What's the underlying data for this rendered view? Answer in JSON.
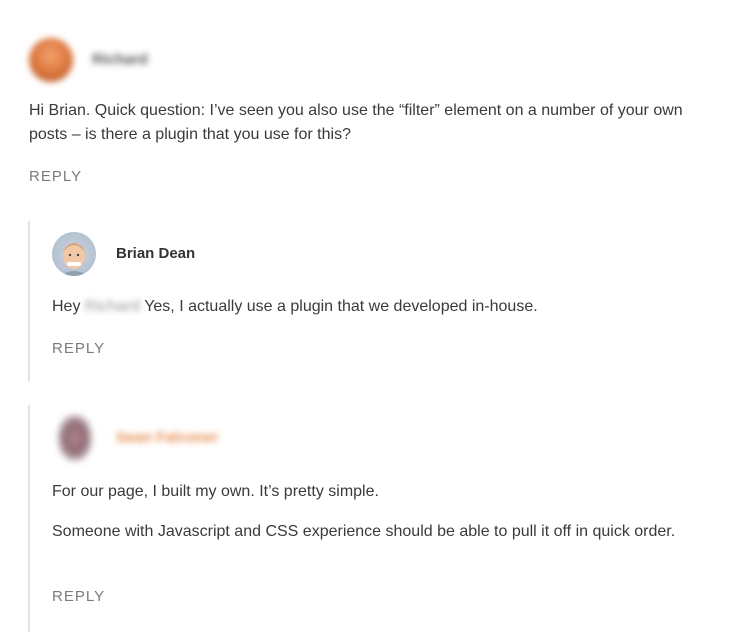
{
  "comments": [
    {
      "author": "Richard",
      "text": "Hi Brian. Quick question: I’ve seen you also use the “filter” element on a number of your own posts – is there a plugin that you use for this?",
      "reply_label": "REPLY"
    },
    {
      "author": "Brian Dean",
      "text_prefix": "Hey",
      "text_mention": "Richard",
      "text_suffix": "Yes, I actually use a plugin that we developed in-house.",
      "reply_label": "REPLY"
    },
    {
      "author": "Sean Falconer",
      "paragraph1": "For our page, I built my own. It’s pretty simple.",
      "paragraph2": "Someone with Javascript and CSS experience should be able to pull it off in quick order.",
      "reply_label": "REPLY"
    }
  ],
  "colors": {
    "author_blurred_orange": "#e58a4a",
    "reply_gray": "#7b7b7b",
    "thread_line": "#e3e3e3"
  }
}
